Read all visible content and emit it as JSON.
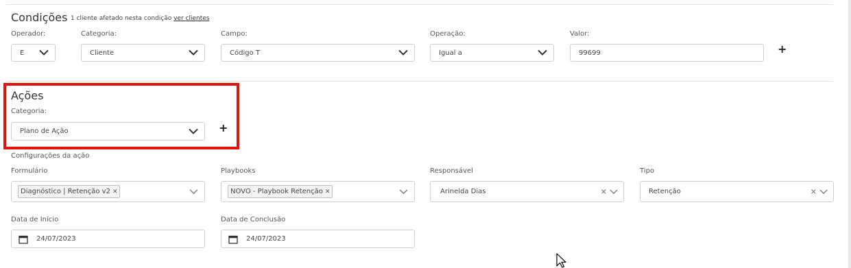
{
  "conditions": {
    "title": "Condições",
    "affected_text": "1 cliente afetado nesta condição",
    "see_clients_link": "ver clientes",
    "operator": {
      "label": "Operador:",
      "value": "E"
    },
    "category": {
      "label": "Categoria:",
      "value": "Cliente"
    },
    "field": {
      "label": "Campo:",
      "value": "Código T"
    },
    "operation": {
      "label": "Operação:",
      "value": "Igual a"
    },
    "value": {
      "label": "Valor:",
      "value": "99699"
    },
    "add_symbol": "+"
  },
  "actions": {
    "title": "Ações",
    "category": {
      "label": "Categoria:",
      "value": "Plano de Ação"
    },
    "add_symbol": "+"
  },
  "config": {
    "title": "Configurações da ação",
    "form": {
      "label": "Formulário",
      "tag": "Diagnóstico | Retenção v2",
      "tag_remove": "✕"
    },
    "playbooks": {
      "label": "Playbooks",
      "tag": "NOVO - Playbook Retenção",
      "tag_remove": "✕"
    },
    "responsible": {
      "label": "Responsável",
      "value": "Arinelda Dias",
      "clear": "✕"
    },
    "type": {
      "label": "Tipo",
      "value": "Retenção",
      "clear": "✕"
    },
    "start_date": {
      "label": "Data de Início",
      "value": "24/07/2023"
    },
    "end_date": {
      "label": "Data de Conclusão",
      "value": "24/07/2023"
    }
  },
  "icons": {
    "chevron": "chevron-down-icon",
    "calendar": "calendar-icon",
    "cursor": "mouse-cursor-icon",
    "highlight_color": "#e3120b"
  }
}
